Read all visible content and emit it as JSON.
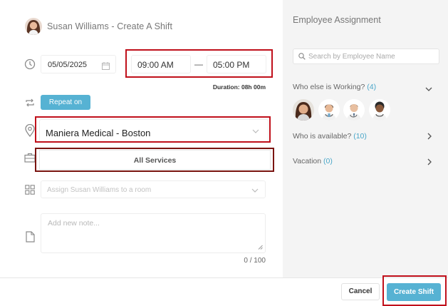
{
  "header": {
    "title": "Susan Williams - Create A Shift"
  },
  "shift": {
    "date": "05/05/2025",
    "start_time": "09:00 AM",
    "separator": "—",
    "end_time": "05:00 PM",
    "duration": "Duration: 08h 00m",
    "repeat_label": "Repeat on",
    "location": "Maniera Medical - Boston",
    "services": "All Services",
    "room_placeholder": "Assign Susan Williams to a room",
    "note_placeholder": "Add new note...",
    "note_counter": "0 / 100"
  },
  "assignment": {
    "title": "Employee Assignment",
    "search_placeholder": "Search by Employee Name",
    "working_label": "Who else is Working?",
    "working_count": "(4)",
    "available_label": "Who is available?",
    "available_count": "(10)",
    "vacation_label": "Vacation",
    "vacation_count": "(0)"
  },
  "footer": {
    "cancel": "Cancel",
    "create": "Create Shift"
  },
  "colors": {
    "accent": "#56b2d3",
    "highlight": "#c0101b",
    "count": "#4aa7c9"
  }
}
